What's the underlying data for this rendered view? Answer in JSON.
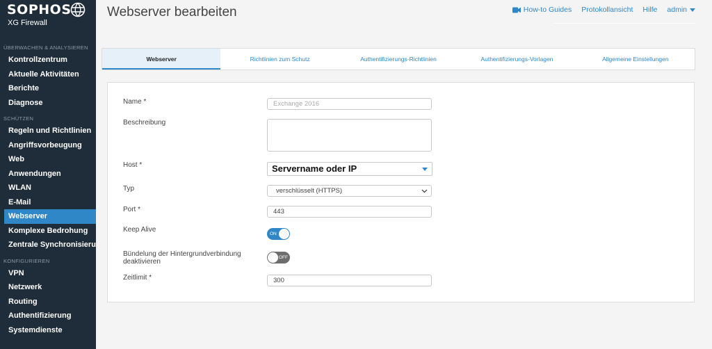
{
  "brand": {
    "name": "SOPHOS",
    "product": "XG Firewall"
  },
  "sidebar": {
    "sections": [
      {
        "label": "ÜBERWACHEN & ANALYSIEREN",
        "items": [
          "Kontrollzentrum",
          "Aktuelle Aktivitäten",
          "Berichte",
          "Diagnose"
        ]
      },
      {
        "label": "SCHÜTZEN",
        "items": [
          "Regeln und Richtlinien",
          "Angriffsvorbeugung",
          "Web",
          "Anwendungen",
          "WLAN",
          "E-Mail",
          "Webserver",
          "Komplexe Bedrohung",
          "Zentrale Synchronisierung"
        ]
      },
      {
        "label": "KONFIGURIEREN",
        "items": [
          "VPN",
          "Netzwerk",
          "Routing",
          "Authentifizierung",
          "Systemdienste"
        ]
      }
    ],
    "active": "Webserver"
  },
  "header": {
    "title": "Webserver bearbeiten",
    "links": {
      "guides": "How-to Guides",
      "log": "Protokollansicht",
      "help": "Hilfe",
      "user": "admin"
    }
  },
  "tabs": [
    "Webserver",
    "Richtlinien zum Schutz",
    "Authentifizierungs-Richtlinien",
    "Authentifizierungs-Vorlagen",
    "Allgemeine Einstellungen"
  ],
  "form": {
    "name_label": "Name *",
    "name_value": "Exchange 2016",
    "desc_label": "Beschreibung",
    "desc_value": "",
    "host_label": "Host *",
    "host_value": "Servername oder IP",
    "type_label": "Typ",
    "type_value": "verschlüsselt (HTTPS)",
    "port_label": "Port *",
    "port_value": "443",
    "keepalive_label": "Keep Alive",
    "keepalive_state": "ON",
    "bundle_label_1": "Bündelung der Hintergrundverbindung",
    "bundle_label_2": "deaktivieren",
    "bundle_state": "OFF",
    "timeout_label": "Zeitlimit *",
    "timeout_value": "300"
  },
  "colors": {
    "sidebar_bg": "#1f2c39",
    "accent": "#2f87c8",
    "active_tab_bg": "#e6f0f8",
    "toggle_off": "#6d6d6d"
  }
}
